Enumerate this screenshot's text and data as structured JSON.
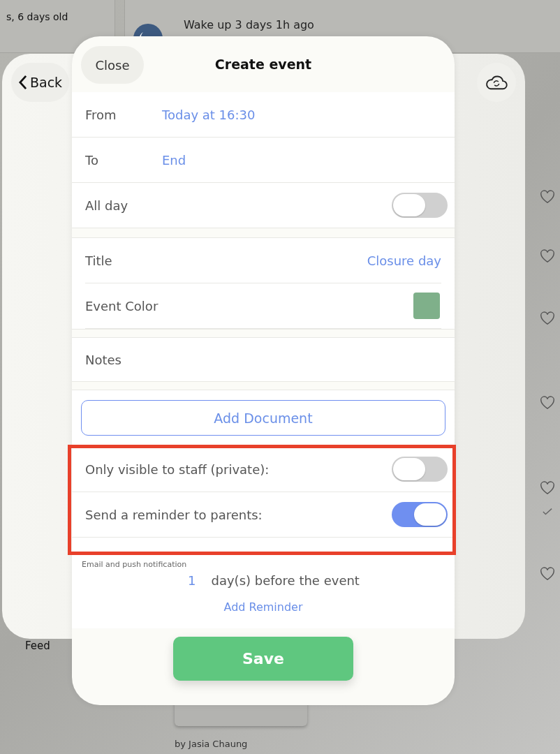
{
  "background": {
    "age_text": "s, 6 days old",
    "activity_text": "Wake up 3 days 1h ago",
    "tab_label": "Feed",
    "byline": "by Jasia Chaung",
    "feed_items": [
      {
        "liked": false,
        "checked": false
      },
      {
        "liked": false,
        "checked": false
      },
      {
        "liked": false,
        "checked": false
      },
      {
        "liked": false,
        "checked": false
      },
      {
        "liked": false,
        "checked": true
      },
      {
        "liked": false,
        "checked": false
      }
    ]
  },
  "back_sheet": {
    "back_button": "Back"
  },
  "modal": {
    "close_button": "Close",
    "title": "Create event",
    "time_rows": [
      {
        "label": "From",
        "value": "Today at 16:30"
      },
      {
        "label": "To",
        "value": "End"
      }
    ],
    "all_day": {
      "label": "All day",
      "on": false
    },
    "title_row": {
      "label": "Title",
      "value": "Closure day"
    },
    "color_row": {
      "label": "Event Color",
      "color": "#7fb08a"
    },
    "notes": {
      "placeholder": "Notes"
    },
    "add_document": "Add Document",
    "toggles": [
      {
        "label": "Only visible to staff (private):",
        "on": false
      },
      {
        "label": "Send a reminder to parents:",
        "on": true
      }
    ],
    "reminder_note": "Email and push notification",
    "reminder": {
      "count": "1",
      "unit": "day(s) before the event"
    },
    "add_reminder": "Add Reminder",
    "save_button": "Save"
  }
}
